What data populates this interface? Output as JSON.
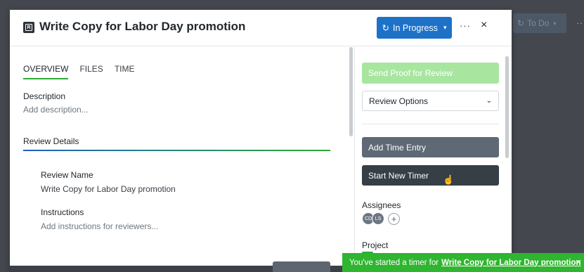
{
  "background": {
    "status_label": "To Do",
    "more": "···"
  },
  "header": {
    "title": "Write Copy for Labor Day promotion",
    "status_label": "In Progress",
    "status_color": "#1d72c8",
    "more": "···",
    "close": "×"
  },
  "tabs": [
    {
      "label": "OVERVIEW",
      "active": true
    },
    {
      "label": "FILES",
      "active": false
    },
    {
      "label": "TIME",
      "active": false
    }
  ],
  "overview": {
    "description_label": "Description",
    "description_placeholder": "Add description...",
    "section_title": "Review Details",
    "review_name_label": "Review Name",
    "review_name_value": "Write Copy for Labor Day promotion",
    "instructions_label": "Instructions",
    "instructions_placeholder": "Add instructions for reviewers..."
  },
  "sidebar": {
    "send_proof_label": "Send Proof for Review",
    "review_options_label": "Review Options",
    "add_time_label": "Add Time Entry",
    "start_timer_label": "Start New Timer",
    "assignees_label": "Assignees",
    "assignees": [
      {
        "initials": "CD"
      },
      {
        "initials": "LS"
      }
    ],
    "add_assignee": "+",
    "project_label": "Project"
  },
  "toast": {
    "prefix": "You've started a timer for",
    "link": "Write Copy for Labor Day promotion",
    "close": "×",
    "color": "#2fb52f"
  }
}
